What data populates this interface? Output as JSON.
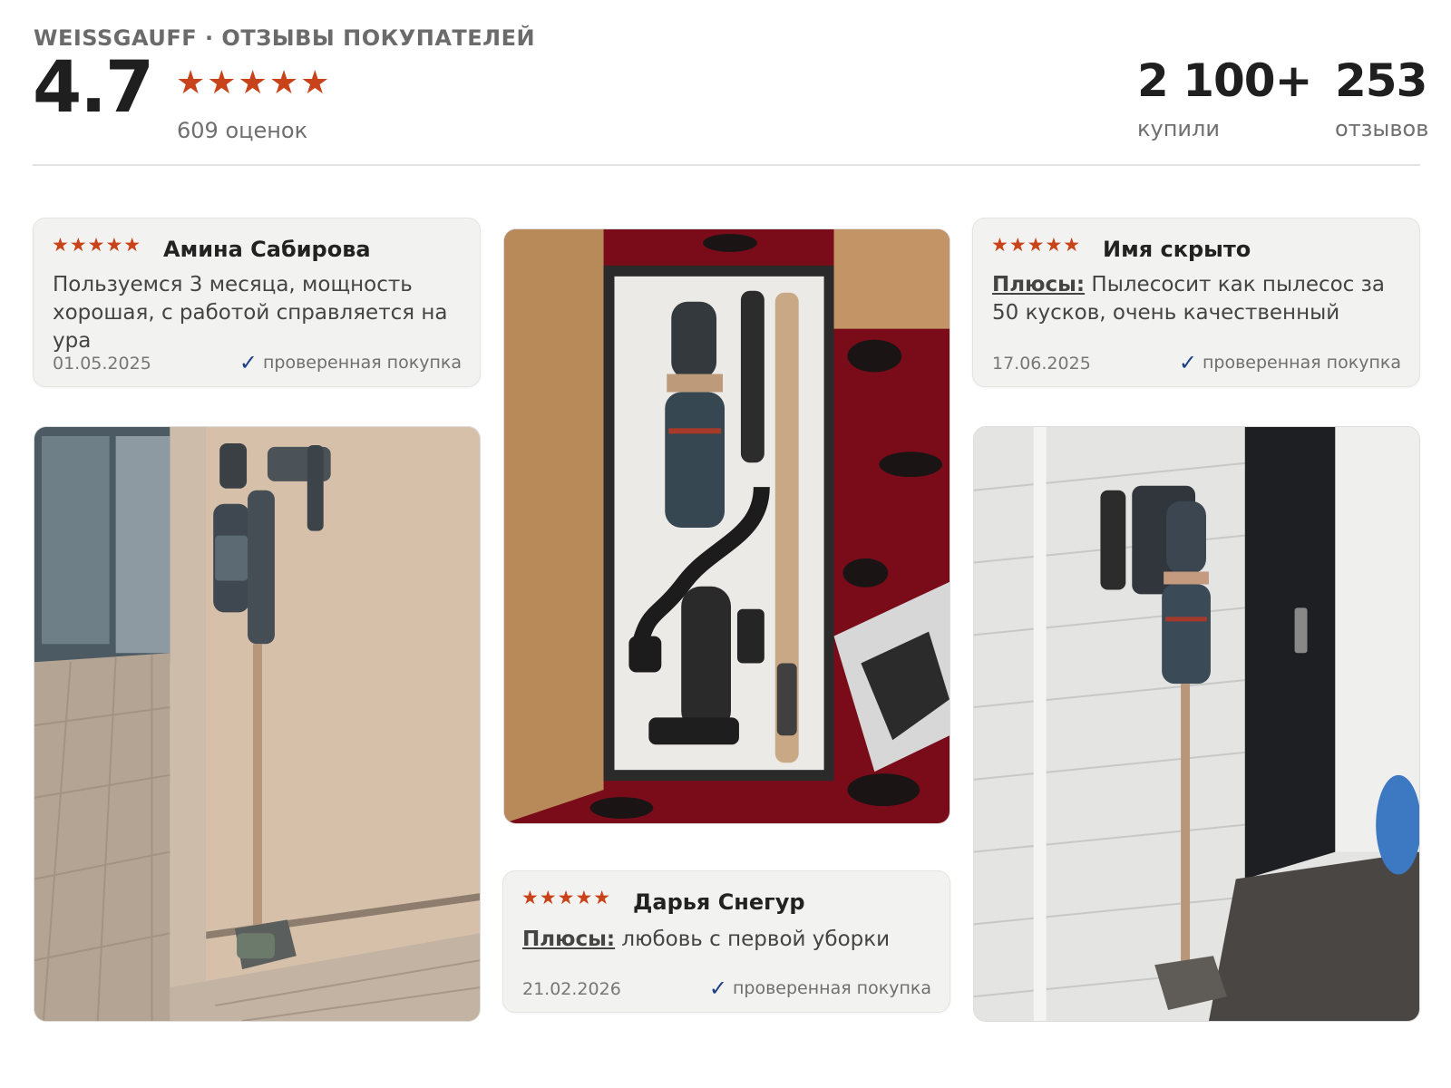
{
  "header": {
    "brand": "WEISSGAUFF · ОТЗЫВЫ ПОКУПАТЕЛЕЙ",
    "score": "4.7",
    "stars": "★★★★★",
    "ratings_count": "609 оценок",
    "rating_value": 4.7,
    "rating_max": 5
  },
  "stats": {
    "bought": {
      "value": "2 100+",
      "label": "купили"
    },
    "reviews": {
      "value": "253",
      "label": "отзывов"
    }
  },
  "reviews": [
    {
      "stars": "★★★★★",
      "author": "Амина Сабирова",
      "plus_label": "",
      "text": "Пользуемся 3 месяца, мощность хорошая, с работой справляется на ура",
      "date": "01.05.2025",
      "verified": "проверенная покупка"
    },
    {
      "stars": "★★★★★",
      "author": "Имя скрыто",
      "plus_label": "Плюсы:",
      "text": " Пылесосит как пылесос за 50 кусков, очень качественный",
      "date": "17.06.2025",
      "verified": "проверенная покупка"
    },
    {
      "stars": "★★★★★",
      "author": "Дарья Снегур",
      "plus_label": "Плюсы:",
      "text": " любовь с первой уборки",
      "date": "21.02.2026",
      "verified": "проверенная покупка"
    }
  ],
  "icons": {
    "star": "star-icon",
    "check": "checkmark-icon"
  },
  "colors": {
    "star": "#c8421a",
    "check": "#1d3f86",
    "card_bg": "#f2f2f0"
  }
}
